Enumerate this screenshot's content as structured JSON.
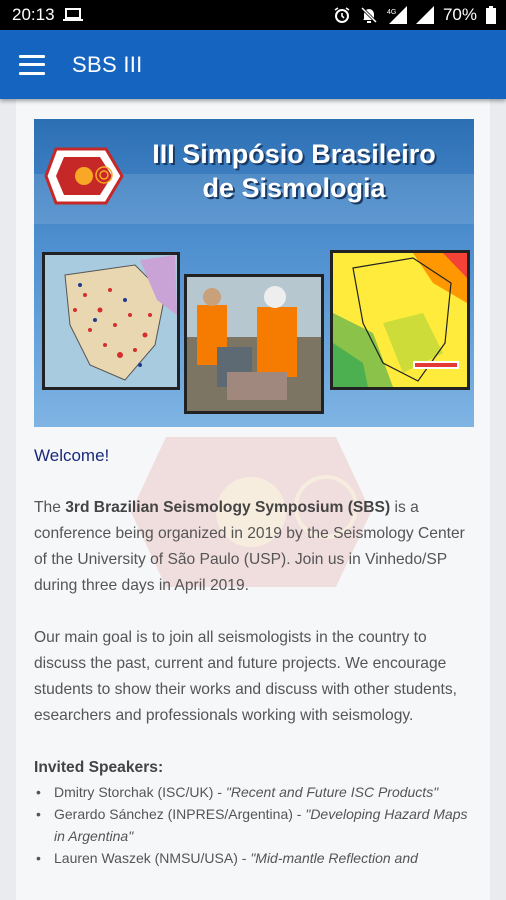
{
  "status": {
    "time": "20:13",
    "battery": "70%"
  },
  "appbar": {
    "title": "SBS III"
  },
  "banner": {
    "line1": "III Simpósio Brasileiro",
    "line2": "de Sismologia"
  },
  "welcome": "Welcome!",
  "intro": {
    "pre": "The ",
    "bold": "3rd Brazilian Seismology Symposium (SBS)",
    "post": " is a conference being organized in 2019 by the Seismology Center of the University of São Paulo (USP). Join us in Vinhedo/SP during three days in April 2019."
  },
  "goal": "Our main goal is to join all seismologists in the country to discuss the past, current and future projects. We encourage students to show their works and discuss with other students, esearchers and professionals working with seismology.",
  "speakers": {
    "title": "Invited Speakers:",
    "items": [
      {
        "name": "Dmitry Storchak (ISC/UK) - ",
        "talk": "\"Recent and Future ISC Products\""
      },
      {
        "name": "Gerardo Sánchez (INPRES/Argentina) - ",
        "talk": "\"Developing Hazard Maps in Argentina\""
      },
      {
        "name": "Lauren Waszek (NMSU/USA) - ",
        "talk": "\"Mid-mantle Reflection and"
      }
    ]
  },
  "colors": {
    "appbar": "#1565c0",
    "statusbar": "#000000",
    "welcome": "#1a2a7a"
  }
}
